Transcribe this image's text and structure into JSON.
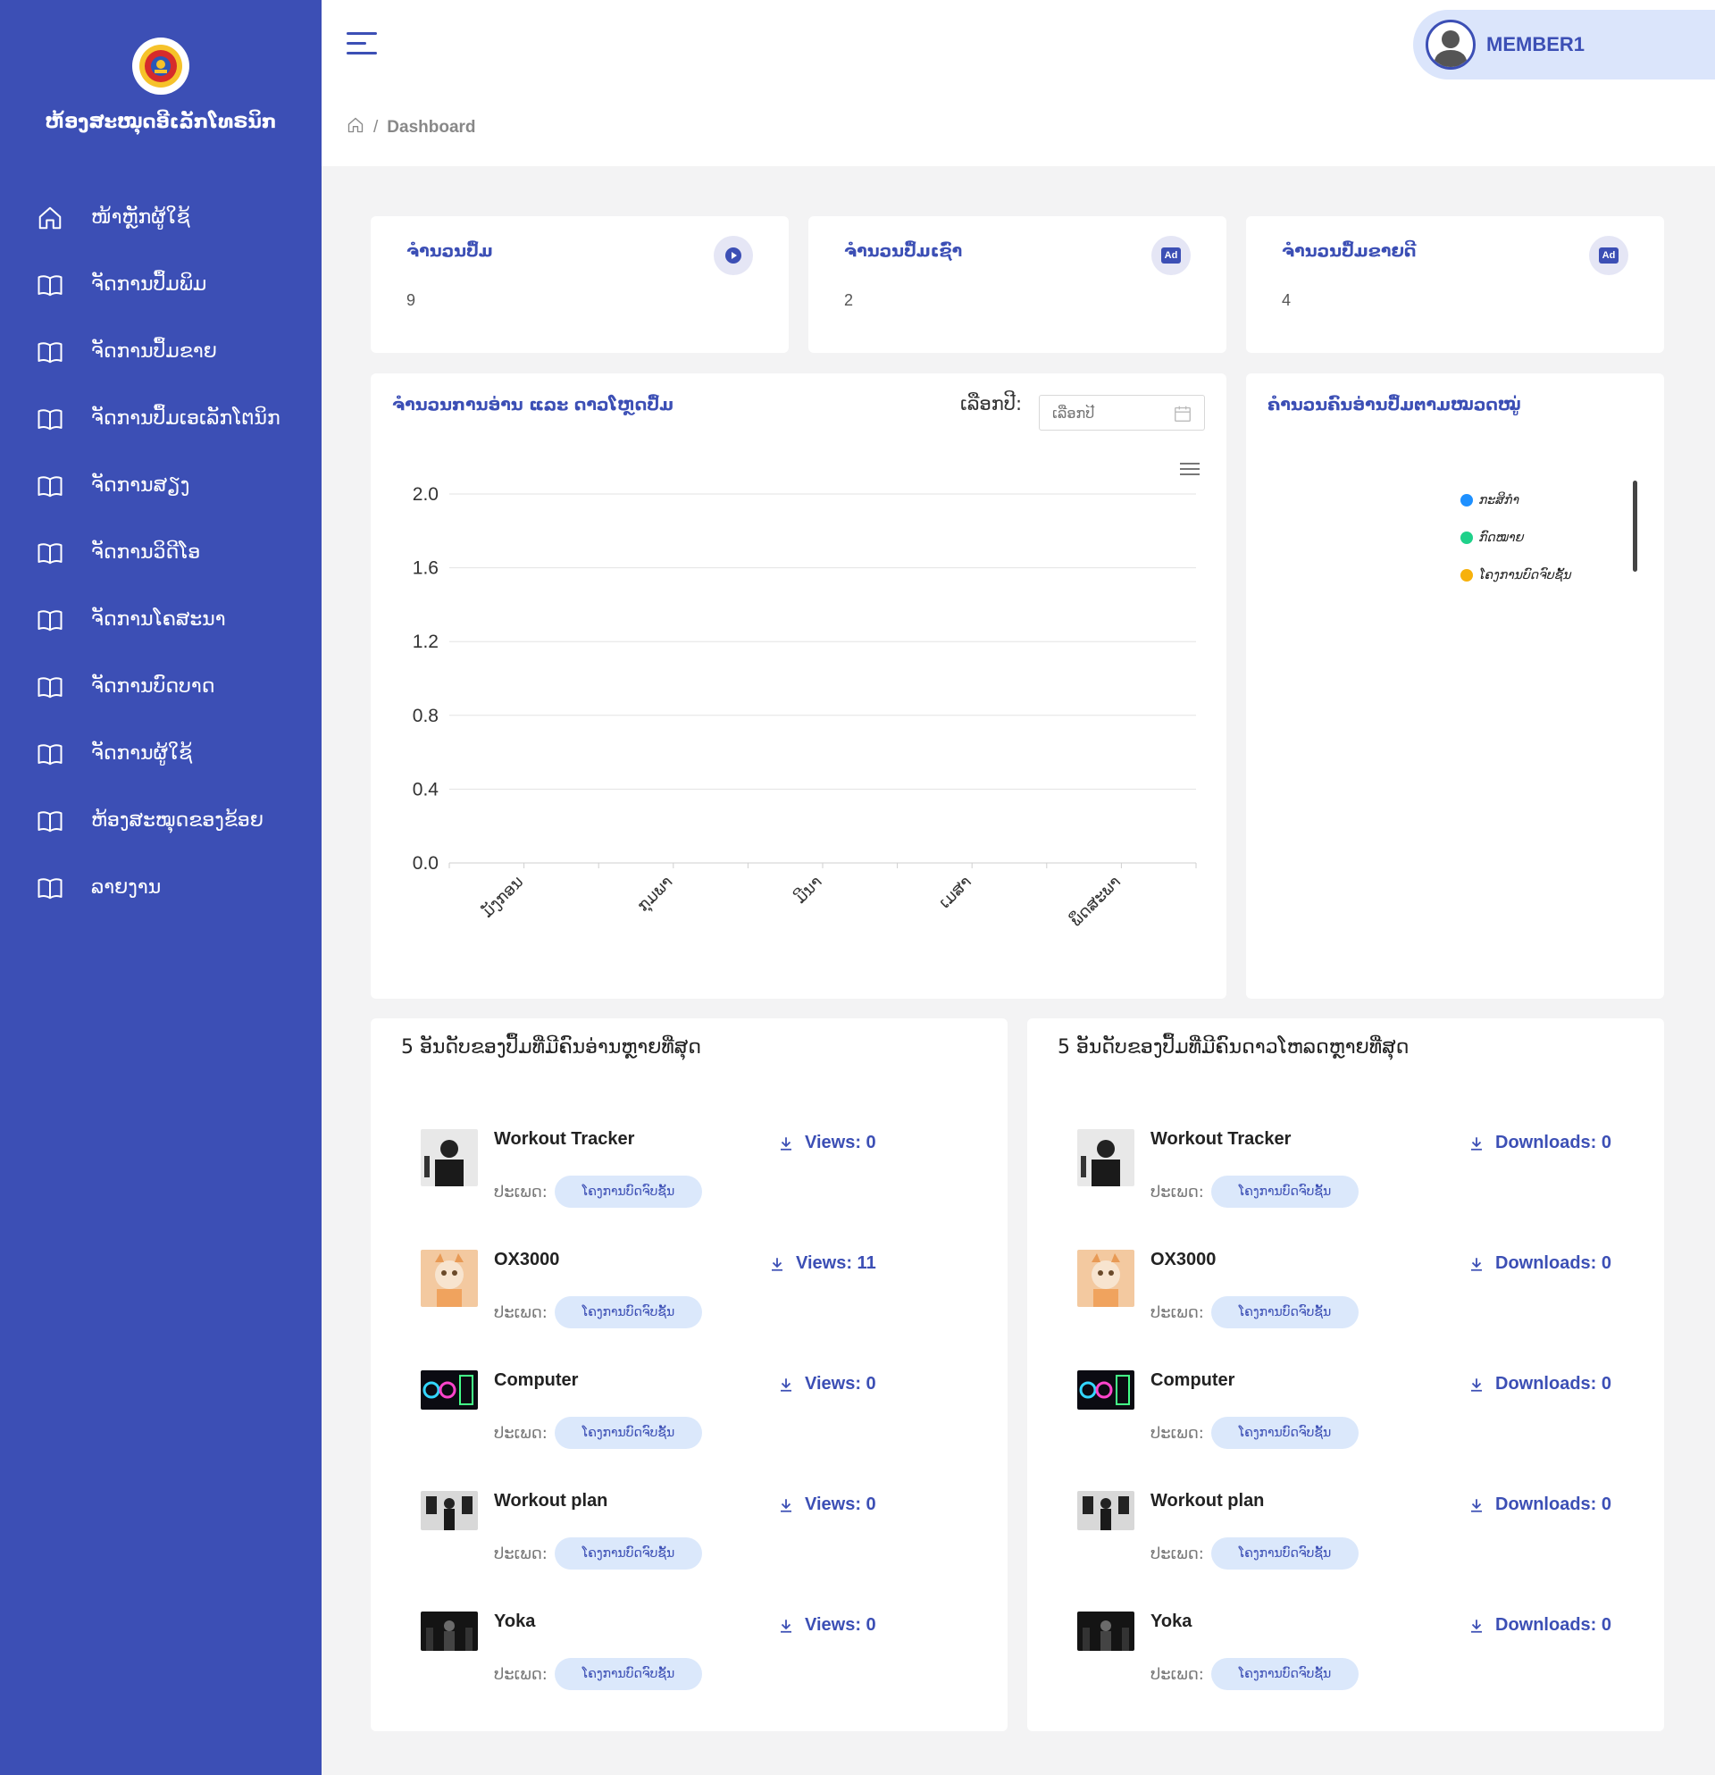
{
  "sidebar": {
    "site_title": "ຫ້ອງສະໝຸດອີເລັກໂທຣນິກ",
    "items": [
      {
        "label": "ໜ້າຫຼັກຜູ້ໃຊ້",
        "icon": "home-icon"
      },
      {
        "label": "ຈັດການປຶ້ມພິມ",
        "icon": "book-icon"
      },
      {
        "label": "ຈັດການປຶ້ມຂາຍ",
        "icon": "book-icon"
      },
      {
        "label": "ຈັດການປຶ້ມເອເລັກໂຕນິກ",
        "icon": "book-icon"
      },
      {
        "label": "ຈັດການສຽງ",
        "icon": "book-icon"
      },
      {
        "label": "ຈັດການວິດີໂອ",
        "icon": "book-icon"
      },
      {
        "label": "ຈັດການໂຄສະນາ",
        "icon": "book-icon"
      },
      {
        "label": "ຈັດການບົດບາດ",
        "icon": "book-icon"
      },
      {
        "label": "ຈັດການຜູ້ໃຊ້",
        "icon": "book-icon"
      },
      {
        "label": "ຫ້ອງສະໝຸດຂອງຂ້ອຍ",
        "icon": "book-icon"
      },
      {
        "label": "ລາຍງານ",
        "icon": "book-icon"
      }
    ]
  },
  "header": {
    "user_name": "MEMBER1",
    "breadcrumb_current": "Dashboard",
    "breadcrumb_sep": "/"
  },
  "stats": [
    {
      "title": "ຈຳນວນປຶ້ມ",
      "value": "9",
      "icon": "play-icon"
    },
    {
      "title": "ຈຳນວນປຶ້ມເຊົ່າ",
      "value": "2",
      "icon": "ad-icon",
      "badge": "Ad"
    },
    {
      "title": "ຈຳນວນປຶ້ມຂາຍດີ",
      "value": "4",
      "icon": "ad-icon",
      "badge": "Ad"
    }
  ],
  "line_chart": {
    "title": "ຈຳນວນການອ່ານ ແລະ ດາວໂຫຼດປຶ້ມ",
    "year_label": "ເລືອກປີ:",
    "year_placeholder": "ເລືອກປີ"
  },
  "chart_data": [
    {
      "type": "line",
      "categories": [
        "ມັງກອນ",
        "ກຸມພາ",
        "ມີນາ",
        "ເມສາ",
        "ພຶດສະພາ"
      ],
      "series": [],
      "yticks": [
        "0.0",
        "0.4",
        "0.8",
        "1.2",
        "1.6",
        "2.0"
      ],
      "ylim": [
        0,
        2
      ],
      "grid": true
    },
    {
      "type": "pie",
      "title": "ຄຳນວນຄົນອ່ານປຶ້ມຕາມໝວດໝູ່",
      "legend": [
        {
          "name": "ກະສິກຳ",
          "color": "#1e90ff"
        },
        {
          "name": "ກົດໝາຍ",
          "color": "#1fd18a"
        },
        {
          "name": "ໂຄງການບົດຈົບຊັ້ນ",
          "color": "#f7b10b"
        }
      ],
      "legend_position": "right"
    }
  ],
  "top_views": {
    "title": "5 ອັນດັບຂອງປຶ້ມທີ່ມີຄົນອ່ານຫຼາຍທີ່ສຸດ",
    "type_label": "ປະເພດ:",
    "items": [
      {
        "title": "Workout Tracker",
        "stat": "Views: 0",
        "type": "ໂຄງການບົດຈົບຊັ້ນ"
      },
      {
        "title": "OX3000",
        "stat": "Views: 11",
        "type": "ໂຄງການບົດຈົບຊັ້ນ"
      },
      {
        "title": "Computer",
        "stat": "Views: 0",
        "type": "ໂຄງການບົດຈົບຊັ້ນ"
      },
      {
        "title": "Workout plan",
        "stat": "Views: 0",
        "type": "ໂຄງການບົດຈົບຊັ້ນ"
      },
      {
        "title": "Yoka",
        "stat": "Views: 0",
        "type": "ໂຄງການບົດຈົບຊັ້ນ"
      }
    ]
  },
  "top_downloads": {
    "title": "5 ອັນດັບຂອງປຶ້ມທີ່ມີຄົນດາວໂຫລດຫຼາຍທີ່ສຸດ",
    "type_label": "ປະເພດ:",
    "items": [
      {
        "title": "Workout Tracker",
        "stat": "Downloads: 0",
        "type": "ໂຄງການບົດຈົບຊັ້ນ"
      },
      {
        "title": "OX3000",
        "stat": "Downloads: 0",
        "type": "ໂຄງການບົດຈົບຊັ້ນ"
      },
      {
        "title": "Computer",
        "stat": "Downloads: 0",
        "type": "ໂຄງການບົດຈົບຊັ້ນ"
      },
      {
        "title": "Workout plan",
        "stat": "Downloads: 0",
        "type": "ໂຄງການບົດຈົບຊັ້ນ"
      },
      {
        "title": "Yoka",
        "stat": "Downloads: 0",
        "type": "ໂຄງການບົດຈົບຊັ້ນ"
      }
    ]
  },
  "colors": {
    "brand": "#3c4fb5",
    "pill_bg": "#dbe8fb",
    "page_bg": "#f3f3f4"
  }
}
